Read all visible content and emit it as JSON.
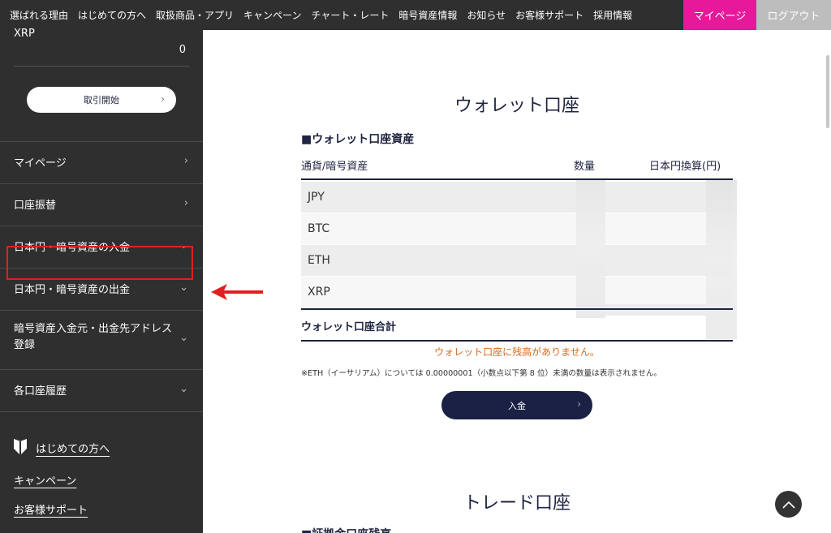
{
  "topnav": {
    "links": [
      "選ばれる理由",
      "はじめての方へ",
      "取扱商品・アプリ",
      "キャンペーン",
      "チャート・レート",
      "暗号資産情報",
      "お知らせ",
      "お客様サポート",
      "採用情報"
    ],
    "mypage": "マイページ",
    "logout": "ログアウト"
  },
  "sidebar": {
    "coin_name": "XRP",
    "coin_value": "0",
    "trade_button": "取引開始",
    "menu": [
      "マイページ",
      "口座振替",
      "日本円・暗号資産の入金",
      "日本円・暗号資産の出金",
      "暗号資産入金元・出金先アドレス登録",
      "各口座履歴"
    ],
    "links": [
      "はじめての方へ",
      "キャンペーン",
      "お客様サポート"
    ]
  },
  "main": {
    "wallet_title": "ウォレット口座",
    "section_head": "■ウォレット口座資産",
    "columns": [
      "通貨/暗号資産",
      "数量",
      "日本円換算(円)"
    ],
    "rows": [
      "JPY",
      "BTC",
      "ETH",
      "XRP"
    ],
    "total_label": "ウォレット口座合計",
    "notice": "ウォレット口座に残高がありません。",
    "footnote": "※ETH（イーサリアム）については 0.00000001（小数点以下第 8 位）未満の数量は表示されません。",
    "deposit_button": "入金",
    "trade_title": "トレード口座",
    "trade_section_head": "■証拠金口座残高"
  },
  "colors": {
    "nav_bg": "#2f2f2f",
    "mypage_accent": "#e6199a",
    "navy": "#1a2145",
    "notice": "#d9691a",
    "highlight": "#e02020"
  }
}
